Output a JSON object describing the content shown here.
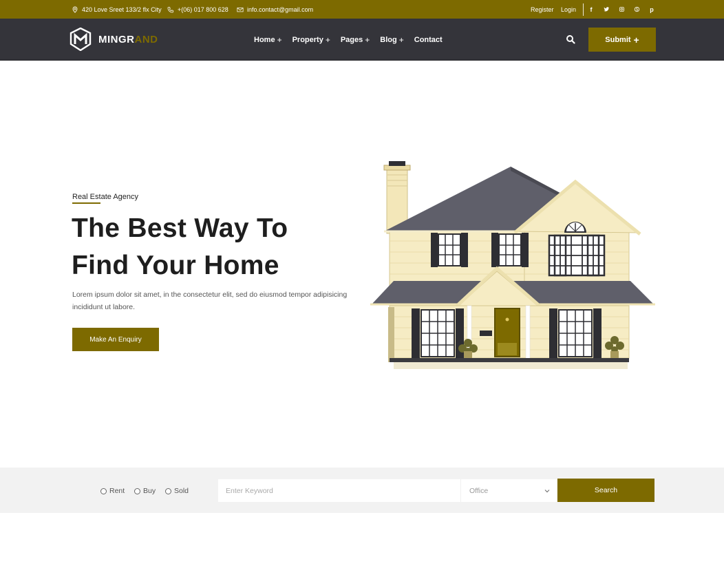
{
  "colors": {
    "accent": "#7d6a00",
    "header_bg": "#34343a",
    "search_strip_bg": "#f2f2f2"
  },
  "topbar": {
    "address": "420 Love Sreet 133/2 flx City",
    "phone": "+(06) 017 800 628",
    "email": "info.contact@gmail.com",
    "register": "Register",
    "login": "Login",
    "social": [
      {
        "icon": "facebook-icon",
        "glyph": "f"
      },
      {
        "icon": "twitter-icon",
        "glyph": "t"
      },
      {
        "icon": "instagram-icon",
        "glyph": "◎"
      },
      {
        "icon": "skype-icon",
        "glyph": "S"
      },
      {
        "icon": "pinterest-icon",
        "glyph": "p"
      }
    ]
  },
  "header": {
    "logo_text_1": "MINGR",
    "logo_text_2": "AND",
    "nav": [
      {
        "label": "Home",
        "plus": "+"
      },
      {
        "label": "Property",
        "plus": "+"
      },
      {
        "label": "Pages",
        "plus": "+"
      },
      {
        "label": "Blog",
        "plus": "+"
      },
      {
        "label": "Contact",
        "plus": ""
      }
    ],
    "search_icon": "search-icon",
    "submit_label": "Submit",
    "submit_plus": "+"
  },
  "hero": {
    "eyebrow": "Real Estate Agency",
    "title_line1": "The Best Way To",
    "title_line2": "Find Your Home",
    "text": "Lorem ipsum dolor sit amet, in the consectetur elit, sed do eiusmod tempor adipisicing incididunt ut labore.",
    "cta": "Make An Enquiry",
    "image": "house-illustration"
  },
  "search": {
    "options": [
      "Rent",
      "Buy",
      "Sold"
    ],
    "keyword_placeholder": "Enter Keyword",
    "type_selected": "Office",
    "button": "Search"
  }
}
